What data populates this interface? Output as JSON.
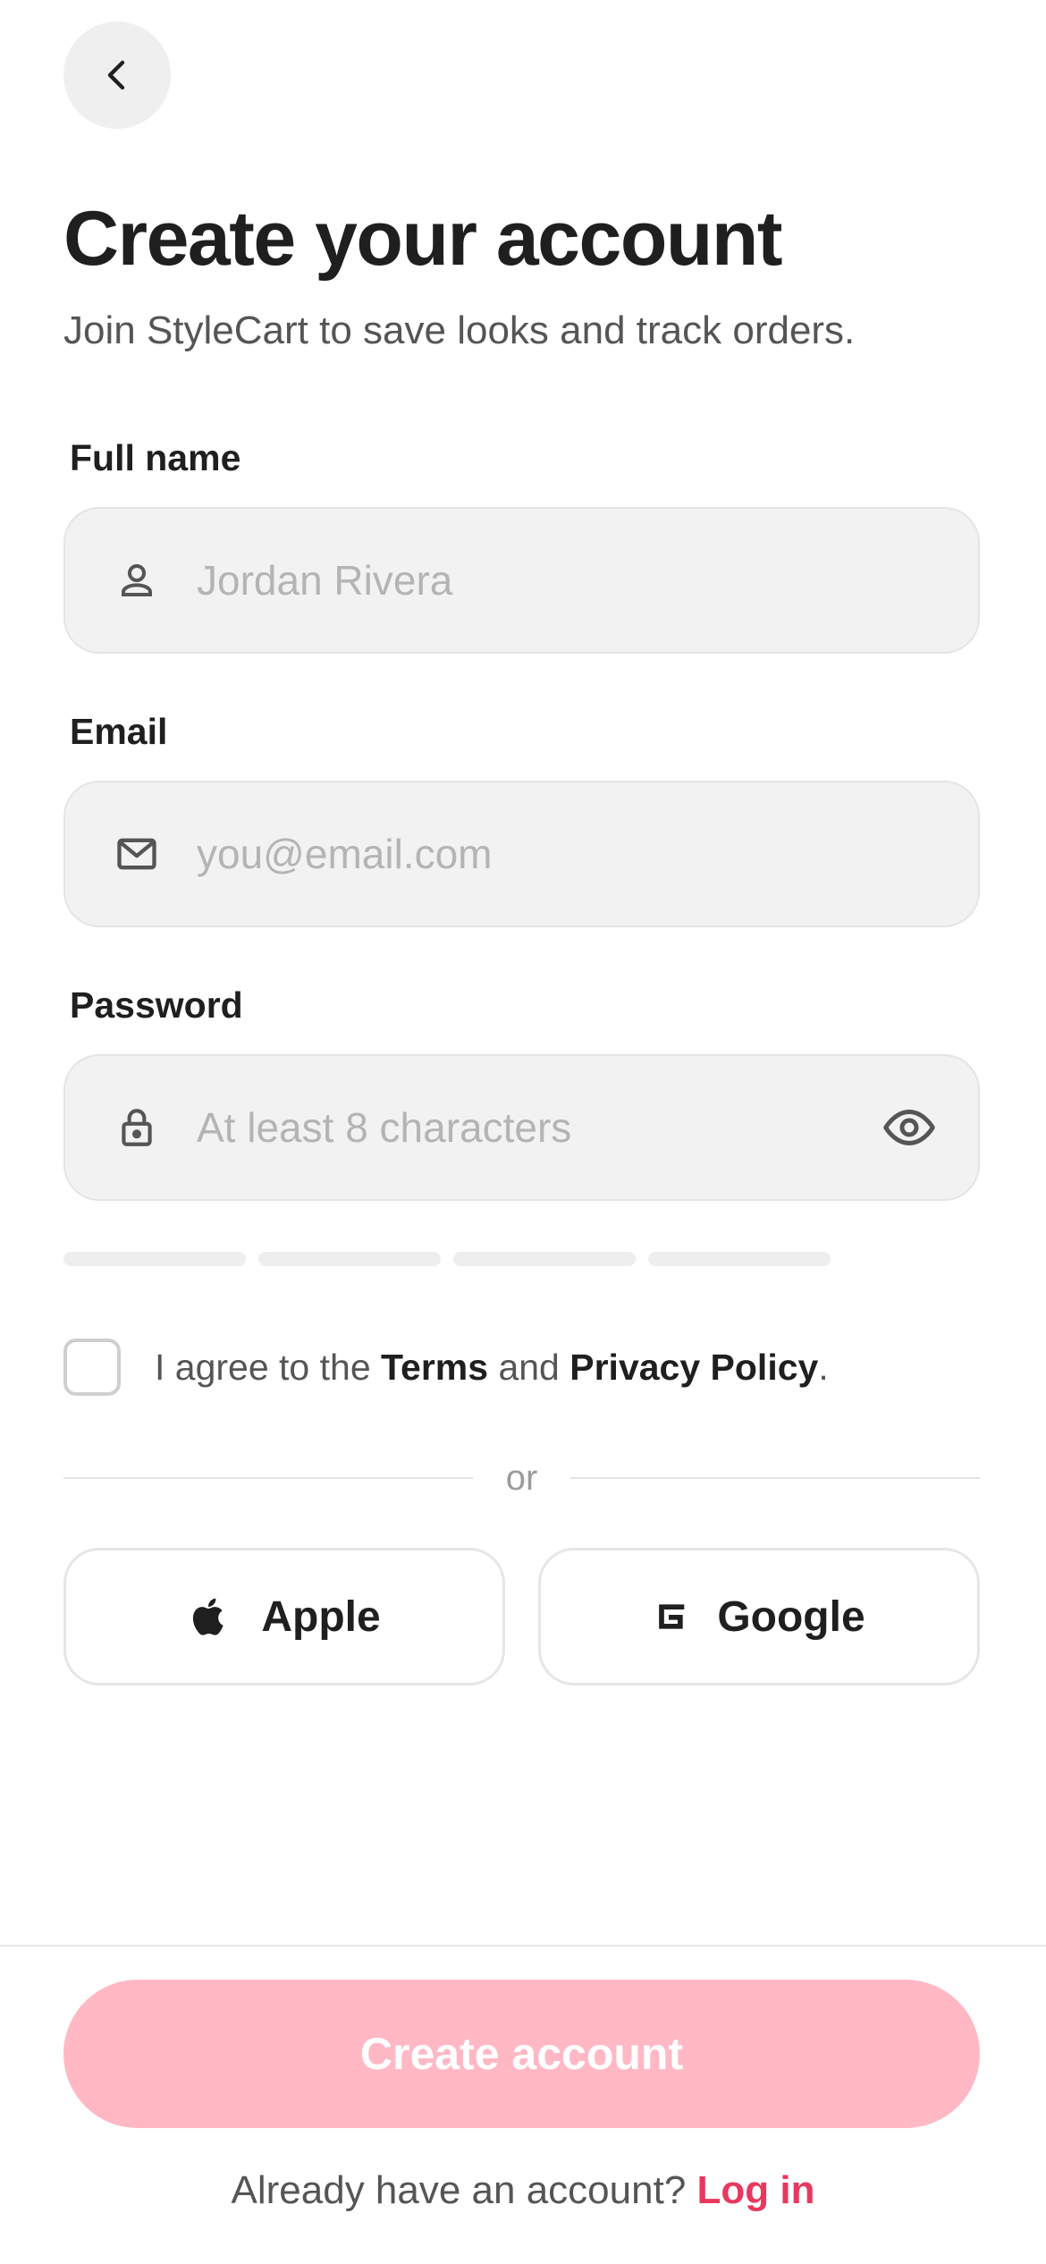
{
  "header": {
    "back_icon": "chevron-left-icon"
  },
  "title": "Create your account",
  "subtitle": "Join StyleCart to save looks and track orders.",
  "fields": {
    "full_name": {
      "label": "Full name",
      "placeholder": "Jordan Rivera",
      "value": "",
      "icon": "person-icon"
    },
    "email": {
      "label": "Email",
      "placeholder": "you@email.com",
      "value": "",
      "icon": "mail-icon"
    },
    "password": {
      "label": "Password",
      "placeholder": "At least 8 characters",
      "value": "",
      "icon": "lock-icon",
      "toggle_icon": "eye-icon"
    }
  },
  "password_strength": {
    "segments": 4,
    "filled": 0
  },
  "terms": {
    "prefix": "I agree to the ",
    "terms_link": "Terms",
    "middle": " and ",
    "privacy_link": "Privacy Policy",
    "suffix": ".",
    "checked": false
  },
  "divider_text": "or",
  "social": {
    "apple": {
      "label": "Apple",
      "icon": "apple-icon"
    },
    "google": {
      "label": "Google",
      "icon": "google-icon"
    }
  },
  "primary_button": {
    "label": "Create account",
    "enabled": false
  },
  "footer": {
    "prompt": "Already have an account? ",
    "link": "Log in"
  },
  "colors": {
    "accent": "#e8385f",
    "primary_disabled": "#ffb8c4",
    "field_bg": "#f2f2f2",
    "text": "#1f1f1f",
    "muted": "#555555"
  }
}
